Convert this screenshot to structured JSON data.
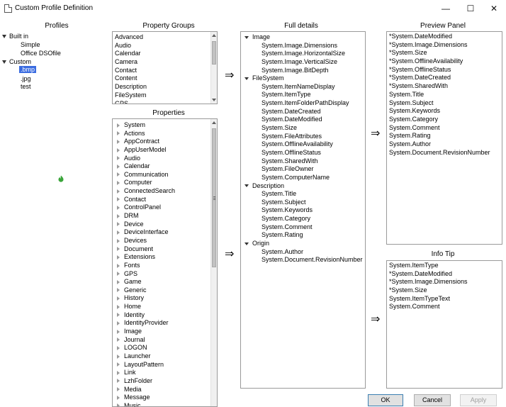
{
  "window": {
    "title": "Custom Profile Definition",
    "minimize_glyph": "—",
    "maximize_glyph": "☐",
    "close_glyph": "✕"
  },
  "profiles": {
    "header": "Profiles",
    "groups": [
      {
        "label": "Built in",
        "items": [
          "Simple",
          "Office DSOfile"
        ]
      },
      {
        "label": "Custom",
        "items": [
          ".bmp",
          ".jpg",
          "test"
        ]
      }
    ],
    "selected": ".bmp"
  },
  "property_groups": {
    "header": "Property Groups",
    "items": [
      "Advanced",
      "Audio",
      "Calendar",
      "Camera",
      "Contact",
      "Content",
      "Description",
      "FileSystem",
      "GPS"
    ]
  },
  "properties": {
    "header": "Properties",
    "items": [
      "System",
      "Actions",
      "AppContract",
      "AppUserModel",
      "Audio",
      "Calendar",
      "Communication",
      "Computer",
      "ConnectedSearch",
      "Contact",
      "ControlPanel",
      "DRM",
      "Device",
      "DeviceInterface",
      "Devices",
      "Document",
      "Extensions",
      "Fonts",
      "GPS",
      "Game",
      "Generic",
      "History",
      "Home",
      "Identity",
      "IdentityProvider",
      "Image",
      "Journal",
      "LOGON",
      "Launcher",
      "LayoutPattern",
      "Link",
      "LzhFolder",
      "Media",
      "Message",
      "Music"
    ]
  },
  "full_details": {
    "header": "Full details",
    "groups": [
      {
        "label": "Image",
        "items": [
          "System.Image.Dimensions",
          "System.Image.HorizontalSize",
          "System.Image.VerticalSize",
          "System.Image.BitDepth"
        ]
      },
      {
        "label": "FileSystem",
        "items": [
          "System.ItemNameDisplay",
          "System.ItemType",
          "System.ItemFolderPathDisplay",
          "System.DateCreated",
          "System.DateModified",
          "System.Size",
          "System.FileAttributes",
          "System.OfflineAvailability",
          "System.OfflineStatus",
          "System.SharedWith",
          "System.FileOwner",
          "System.ComputerName"
        ]
      },
      {
        "label": "Description",
        "items": [
          "System.Title",
          "System.Subject",
          "System.Keywords",
          "System.Category",
          "System.Comment",
          "System.Rating"
        ]
      },
      {
        "label": "Origin",
        "items": [
          "System.Author",
          "System.Document.RevisionNumber"
        ]
      }
    ]
  },
  "preview_panel": {
    "header": "Preview Panel",
    "items": [
      "*System.DateModified",
      "*System.Image.Dimensions",
      "*System.Size",
      "*System.OfflineAvailability",
      "*System.OfflineStatus",
      "*System.DateCreated",
      "*System.SharedWith",
      "System.Title",
      "System.Subject",
      "System.Keywords",
      "System.Category",
      "System.Comment",
      "System.Rating",
      "System.Author",
      "System.Document.RevisionNumber"
    ]
  },
  "info_tip": {
    "header": "Info Tip",
    "items": [
      "System.ItemType",
      "*System.DateModified",
      "*System.Image.Dimensions",
      "*System.Size",
      "System.ItemTypeText",
      "System.Comment"
    ]
  },
  "arrows": {
    "glyph": "⇒"
  },
  "buttons": {
    "ok": "OK",
    "cancel": "Cancel",
    "apply": "Apply"
  },
  "colors": {
    "selection": "#3b6ce0",
    "spinner": "#3aa53a"
  }
}
